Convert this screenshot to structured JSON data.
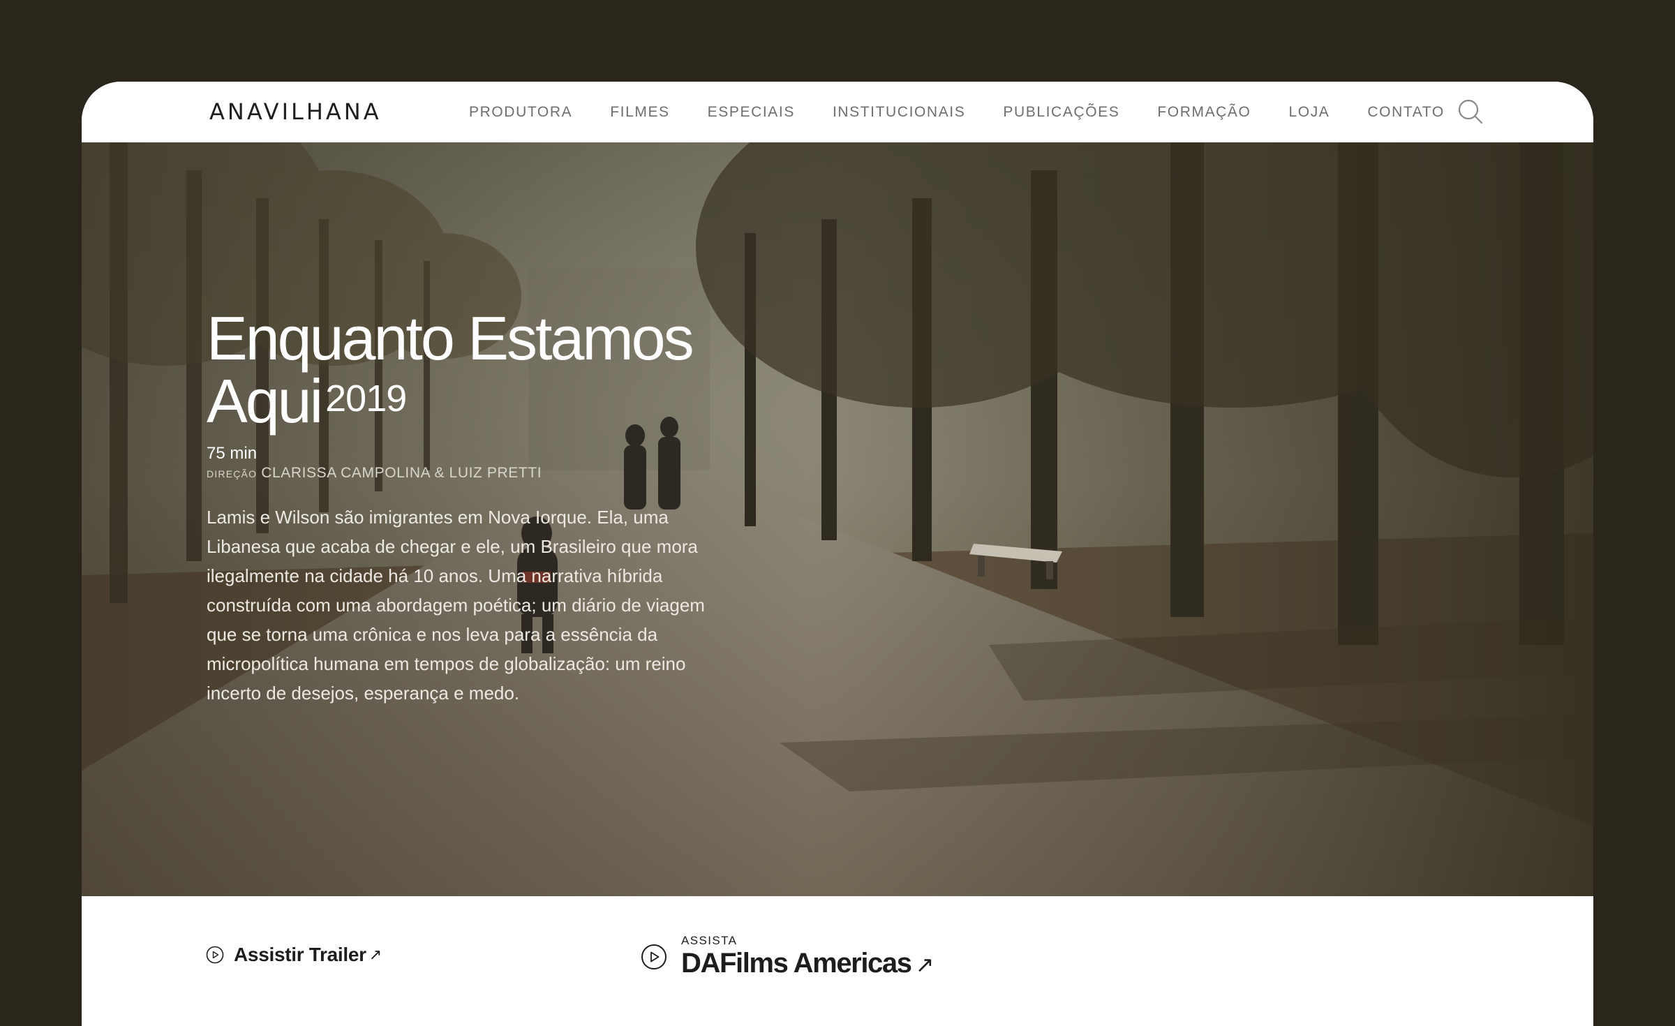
{
  "header": {
    "logo": "ANAVILHANA",
    "nav": [
      {
        "label": "PRODUTORA"
      },
      {
        "label": "FILMES"
      },
      {
        "label": "ESPECIAIS"
      },
      {
        "label": "INSTITUCIONAIS"
      },
      {
        "label": "PUBLICAÇÕES"
      },
      {
        "label": "FORMAÇÃO"
      },
      {
        "label": "LOJA"
      },
      {
        "label": "CONTATO"
      }
    ],
    "search_icon": "search-icon"
  },
  "film": {
    "title": "Enquanto Estamos Aqui",
    "year": "2019",
    "duration": "75 min",
    "direction_label": "DIREÇÃO",
    "directors": "CLARISSA CAMPOLINA & LUIZ PRETTI",
    "synopsis": "Lamis e Wilson são imigrantes em Nova Iorque. Ela, uma Libanesa que acaba de chegar e ele, um Brasileiro que mora ilegalmente na cidade há 10 anos. Uma narrativa híbrida construída com uma abordagem poética; um diário de viagem que se torna uma crônica e nos leva para a essência da micropolítica humana em tempos de globalização: um reino incerto de desejos, esperança e medo."
  },
  "actions": {
    "trailer_label": "Assistir Trailer",
    "trailer_arrow": "↗",
    "watch_kicker": "ASSISTA",
    "watch_platform": "DAFilms Americas",
    "watch_arrow": "↗",
    "play_icon": "play-circle-icon"
  },
  "colors": {
    "page_background": "#2b261c",
    "text_dark": "#1d1d1d",
    "nav_gray": "#6e6e6e"
  }
}
